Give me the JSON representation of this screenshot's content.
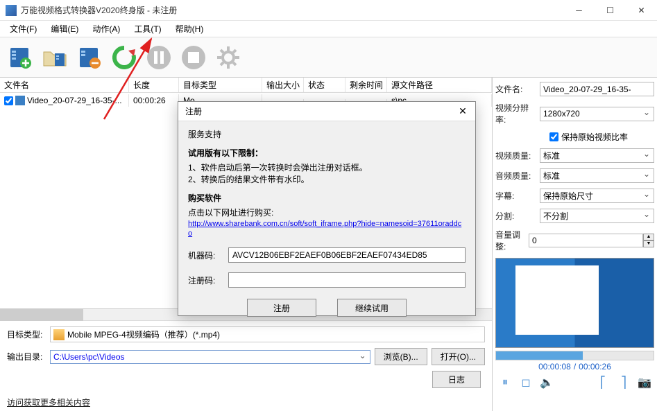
{
  "titlebar": {
    "title": "万能视频格式转换器V2020终身版 - 未注册"
  },
  "menu": {
    "file": "文件(F)",
    "edit": "编辑(E)",
    "action": "动作(A)",
    "tools": "工具(T)",
    "help": "帮助(H)"
  },
  "table": {
    "headers": {
      "name": "文件名",
      "length": "长度",
      "target": "目标类型",
      "size": "输出大小",
      "status": "状态",
      "remain": "剩余时间",
      "path": "源文件路径"
    },
    "rows": [
      {
        "name": "Video_20-07-29_16-35-...",
        "length": "00:00:26",
        "target": "Mo",
        "path_suffix": "s\\pc"
      }
    ]
  },
  "bottom": {
    "target_label": "目标类型:",
    "target_value": "Mobile MPEG-4视频编码（推荐）(*.mp4)",
    "output_label": "输出目录:",
    "output_value": "C:\\Users\\pc\\Videos",
    "browse": "浏览(B)...",
    "open": "打开(O)...",
    "log": "日志",
    "footer_link": "访问获取更多相关内容"
  },
  "props": {
    "filename_label": "文件名:",
    "filename_value": "Video_20-07-29_16-35-",
    "resolution_label": "视频分辨率:",
    "resolution_value": "1280x720",
    "keep_ratio": "保持原始视频比率",
    "video_quality_label": "视频质量:",
    "video_quality_value": "标准",
    "audio_quality_label": "音频质量:",
    "audio_quality_value": "标准",
    "subtitle_label": "字幕:",
    "subtitle_value": "保持原始尺寸",
    "split_label": "分割:",
    "split_value": "不分割",
    "volume_label": "音量调整:",
    "volume_value": "0"
  },
  "preview": {
    "time_current": "00:00:08",
    "time_total": "00:00:26"
  },
  "dialog": {
    "title": "注册",
    "service": "服务支持",
    "trial_heading": "试用版有以下限制：",
    "trial_1": "1、软件启动后第一次转换时会弹出注册对话框。",
    "trial_2": "2、转换后的结果文件带有水印。",
    "buy_heading": "购买软件",
    "buy_desc": "点击以下网址进行购买:",
    "buy_url": "http://www.sharebank.com.cn/soft/soft_iframe.php?hide=namesoid=37611oraddco",
    "machine_label": "机器码:",
    "machine_code": "AVCV12B06EBF2EAEF0B06EBF2EAEF07434ED85",
    "reg_label": "注册码:",
    "reg_value": "",
    "btn_register": "注册",
    "btn_trial": "继续试用"
  }
}
